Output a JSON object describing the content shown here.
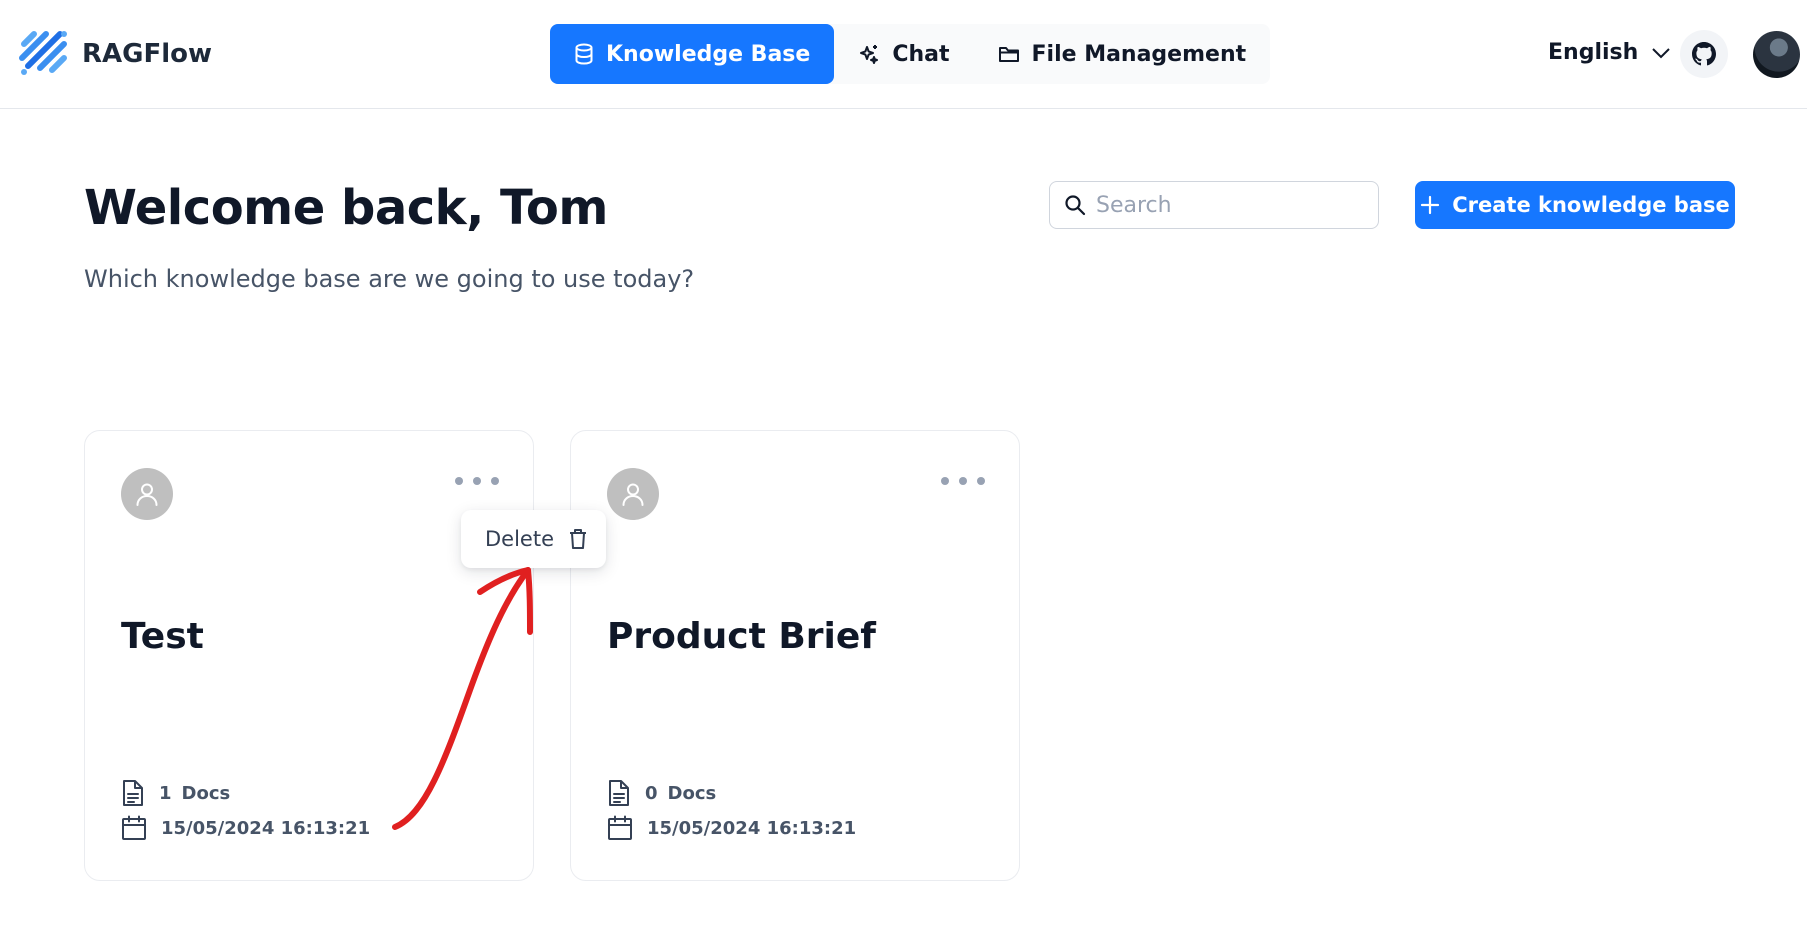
{
  "app": {
    "name": "RAGFlow"
  },
  "nav": {
    "items": [
      {
        "label": "Knowledge Base",
        "icon": "database-icon",
        "active": true
      },
      {
        "label": "Chat",
        "icon": "sparkles-icon",
        "active": false
      },
      {
        "label": "File Management",
        "icon": "folder-icon",
        "active": false
      }
    ]
  },
  "header": {
    "language": "English"
  },
  "welcome": {
    "title": "Welcome back, Tom",
    "subtitle": "Which knowledge base are we going to use today?"
  },
  "search": {
    "placeholder": "Search",
    "value": ""
  },
  "create_button": {
    "label": "Create knowledge base"
  },
  "cards": [
    {
      "title": "Test",
      "docs_count": "1",
      "docs_label": "Docs",
      "date": "15/05/2024 16:13:21"
    },
    {
      "title": "Product Brief",
      "docs_count": "0",
      "docs_label": "Docs",
      "date": "15/05/2024 16:13:21"
    }
  ],
  "dropdown": {
    "delete_label": "Delete"
  },
  "colors": {
    "primary": "#1677ff",
    "annotation": "#e02020"
  }
}
